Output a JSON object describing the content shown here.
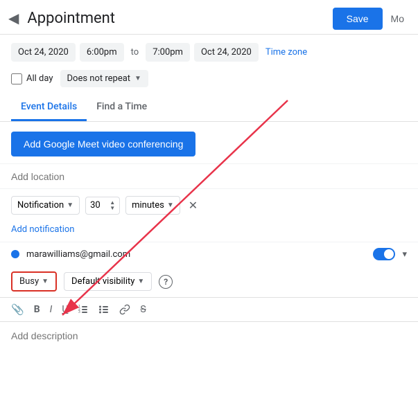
{
  "header": {
    "back_icon": "◀",
    "title": "Appointment",
    "save_label": "Save",
    "more_label": "Mo"
  },
  "datetime": {
    "start_date": "Oct 24, 2020",
    "start_time": "6:00pm",
    "to_label": "to",
    "end_time": "7:00pm",
    "end_date": "Oct 24, 2020",
    "timezone_label": "Time zone"
  },
  "options": {
    "allday_label": "All day",
    "repeat_label": "Does not repeat"
  },
  "tabs": [
    {
      "label": "Event Details",
      "active": true
    },
    {
      "label": "Find a Time",
      "active": false
    }
  ],
  "meet_button": "Add Google Meet video conferencing",
  "location_placeholder": "Add location",
  "notification": {
    "type": "Notification",
    "value": "30",
    "unit": "minutes",
    "close_icon": "✕"
  },
  "add_notification_label": "Add notification",
  "calendar": {
    "email": "marawilliams@gmail.com",
    "dropdown_icon": "▾"
  },
  "status": {
    "busy_label": "Busy",
    "visibility_label": "Default visibility",
    "help_icon": "?"
  },
  "toolbar": {
    "attachment_icon": "📎",
    "bold_icon": "B",
    "italic_icon": "I",
    "underline_icon": "U",
    "ordered_list_icon": "≡",
    "unordered_list_icon": "≡",
    "link_icon": "🔗",
    "strikethrough_icon": "S̶"
  },
  "description_placeholder": "Add description"
}
